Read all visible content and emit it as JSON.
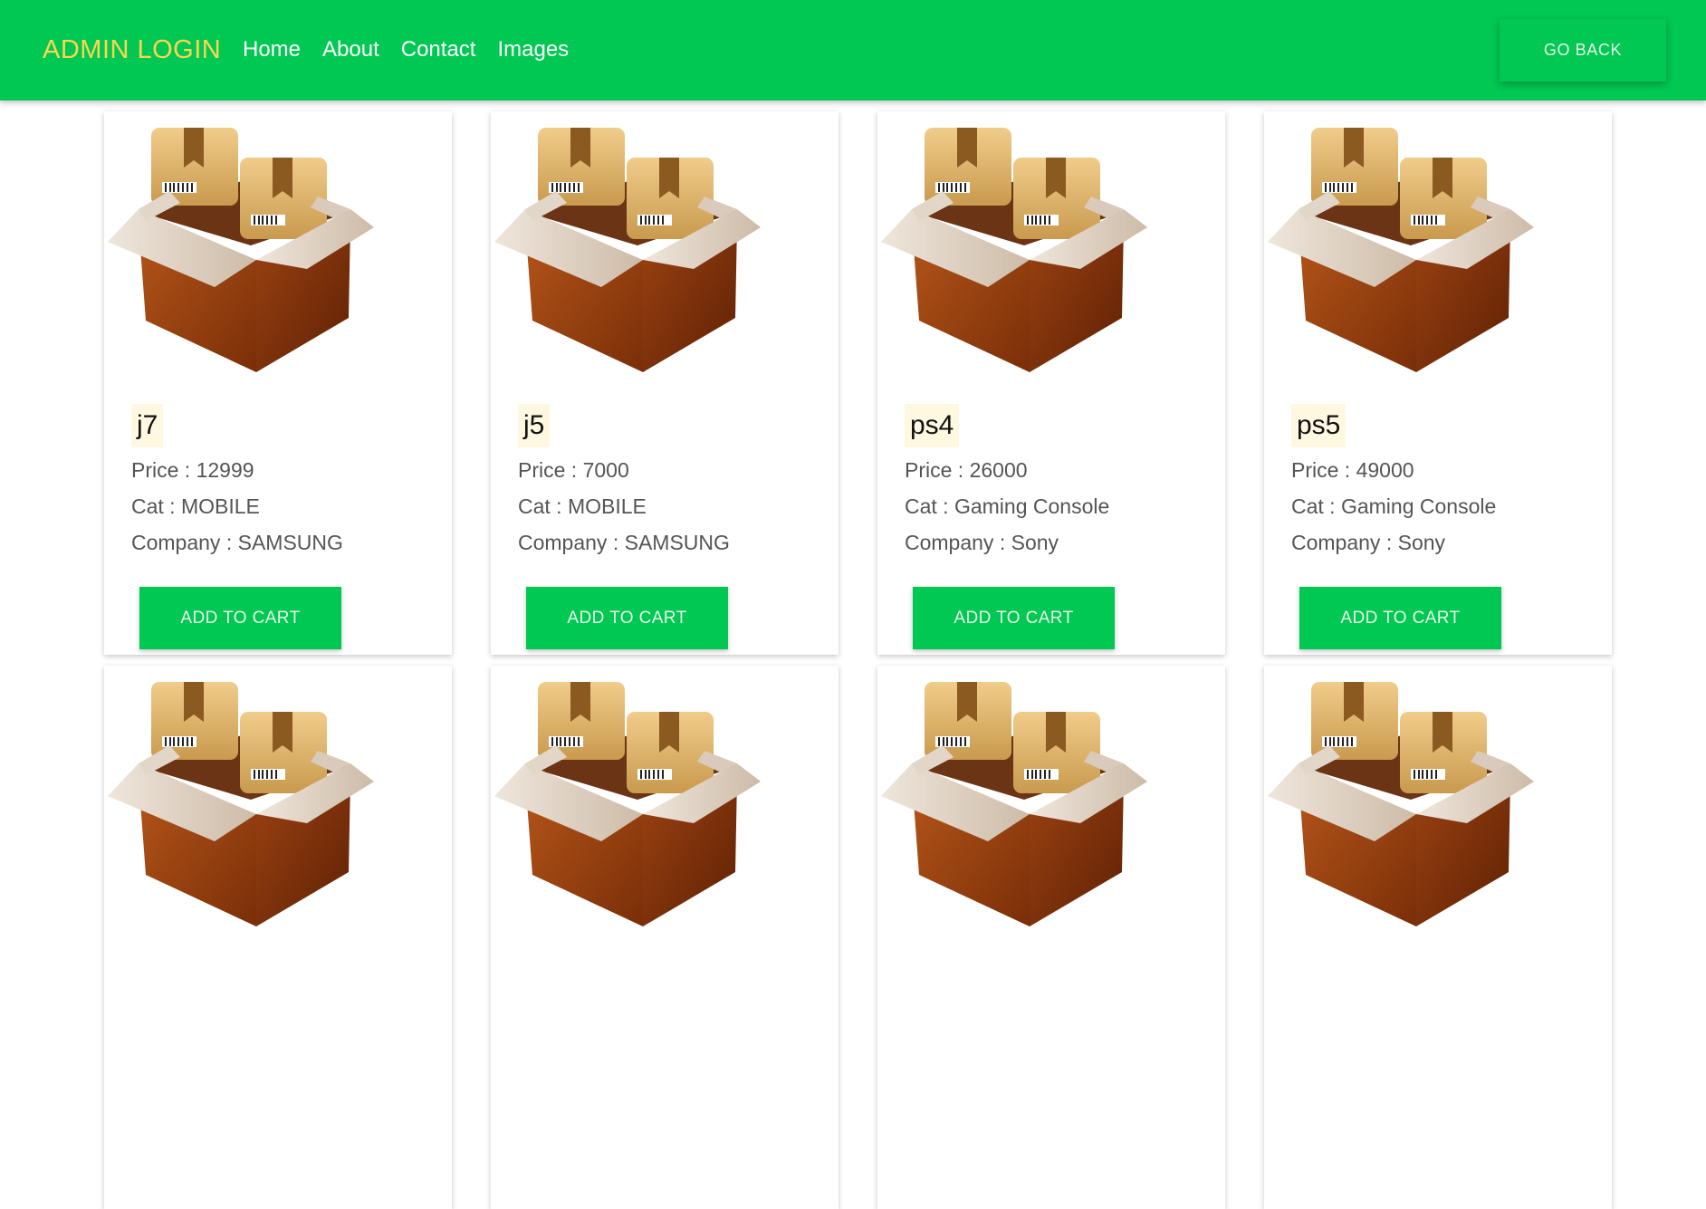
{
  "nav": {
    "brand": "ADMIN LOGIN",
    "links": [
      "Home",
      "About",
      "Contact",
      "Images"
    ],
    "go_back": "GO BACK"
  },
  "colors": {
    "navbar": "#00c853",
    "brand": "#ffd54f",
    "button": "#00c853",
    "name_highlight": "#fff8e1"
  },
  "card_icon": "open-cardboard-box-icon",
  "products": [
    {
      "name": "j7",
      "price": "Price : 12999",
      "cat": "Cat : MOBILE",
      "company": "Company : SAMSUNG",
      "button": "ADD TO CART"
    },
    {
      "name": "j5",
      "price": "Price : 7000",
      "cat": "Cat : MOBILE",
      "company": "Company : SAMSUNG",
      "button": "ADD TO CART"
    },
    {
      "name": "ps4",
      "price": "Price : 26000",
      "cat": "Cat : Gaming Console",
      "company": "Company : Sony",
      "button": "ADD TO CART"
    },
    {
      "name": "ps5",
      "price": "Price : 49000",
      "cat": "Cat : Gaming Console",
      "company": "Company : Sony",
      "button": "ADD TO CART"
    },
    {
      "name": "",
      "price": "",
      "cat": "",
      "company": "",
      "button": ""
    },
    {
      "name": "",
      "price": "",
      "cat": "",
      "company": "",
      "button": ""
    },
    {
      "name": "",
      "price": "",
      "cat": "",
      "company": "",
      "button": ""
    },
    {
      "name": "",
      "price": "",
      "cat": "",
      "company": "",
      "button": ""
    }
  ]
}
